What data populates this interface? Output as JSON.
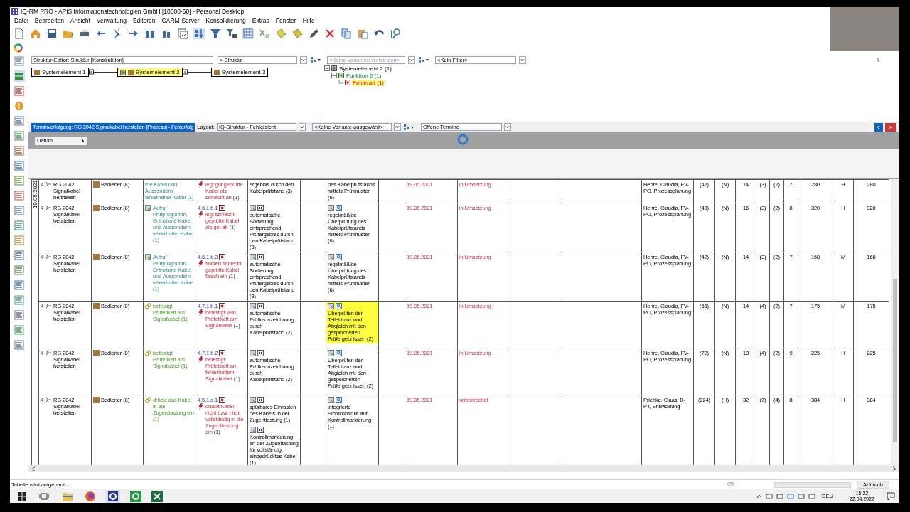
{
  "window": {
    "title": "IQ-RM PRO - APIS Informationstechnologien GmbH [10000-50] - Personal Desktop"
  },
  "menu": [
    "Datei",
    "Bearbeiten",
    "Ansicht",
    "Verwaltung",
    "Editoren",
    "CARM-Server",
    "Konsolidierung",
    "Extras",
    "Fenster",
    "Hilfe"
  ],
  "structure_editor": {
    "title": "Struktur-Editor: Struktur [Konstruktion]",
    "structure": "> Struktur",
    "variants": {
      "value": "<Keine Varianten vorhanden>",
      "disabled": true
    },
    "filter": "<Kein Filter>",
    "nodes": [
      {
        "label": "Systemelement 1",
        "selected": false
      },
      {
        "label": "Systemelement 2",
        "selected": true
      },
      {
        "label": "Systemelement 3",
        "selected": false
      }
    ],
    "tree": [
      {
        "kind": "system",
        "label": "Systemelement 2 (1)",
        "selected": false,
        "expanded": true,
        "children": [
          {
            "kind": "function",
            "label": "Funktion 2 (1)",
            "selected": false,
            "expanded": true,
            "children": [
              {
                "kind": "failure",
                "label": "Fehlerart (1)",
                "selected": true
              }
            ]
          }
        ]
      }
    ]
  },
  "schedule_bar": {
    "title": "Terminverfolgung: RG 2042 Signalkabel herstellen [Prozess] - Fehlerfolg",
    "layout_label": "Layout:",
    "layout": "IQ-Struktur - Fehlersicht",
    "variant": "<Keine Variante ausgewählt>",
    "filter": "Offene Termine"
  },
  "sort_header": {
    "label": "Datum",
    "sort": "▲"
  },
  "date_group": "19.05.2021",
  "rows": [
    {
      "number": "4",
      "process": "RG 2042 Signalkabel herstellen",
      "role": "Bediener (8)",
      "function": {
        "kind": "step",
        "text": "me Kabel und Aussondern fehlerhafter Kabel (1)",
        "icon": false
      },
      "failure": {
        "text": "legt gut geprüfte Kabel als schlecht ab",
        "count": "(1)"
      },
      "measures": [
        {
          "text": "ergebnis durch den Kabelprüfstand (3)",
          "icons": false
        }
      ],
      "planned": {
        "text": "des Kabelprüfstands mittels Prüfmuster (6)",
        "icons": false,
        "highlighted": false
      },
      "date": "19.05.2021",
      "status": "in Umsetzung",
      "responsible": "Hehre, Claudia, FV-PO, Prozessplanung",
      "values": [
        "(42)",
        "(N)",
        "14",
        "(3)",
        "(2)",
        "7",
        "280",
        "H",
        "280"
      ]
    },
    {
      "number": "4",
      "process": "RG 2042 Signalkabel herstellen",
      "role": "Bediener (8)",
      "function": {
        "kind": "step",
        "text": "Aufruf Prüfprogramm, Entnahme Kabel und Aussondern fehlerhafter Kabel (1)",
        "icon": true
      },
      "failure": {
        "code": "4.6.1.b.1",
        "text": "legt schlecht geprüfte Kabel als gut ab",
        "count": "(1)"
      },
      "measures": [
        {
          "text": "automatische Sortierung entsprechend Prüfergebnis durch den Kabelprüfstand (3)",
          "icons": true
        }
      ],
      "planned": {
        "text": "regelmäßige Überprüfung des Kabelprüfstands mittels Prüfmuster (6)",
        "icons": true,
        "highlighted": false
      },
      "date": "19.05.2021",
      "status": "in Umsetzung",
      "responsible": "Hehre, Claudia, FV-PO, Prozessplanung",
      "values": [
        "(48)",
        "(N)",
        "16",
        "(3)",
        "(2)",
        "8",
        "320",
        "H",
        "320"
      ]
    },
    {
      "number": "4",
      "process": "RG 2042 Signalkabel herstellen",
      "role": "Bediener (8)",
      "function": {
        "kind": "step",
        "text": "Aufruf Prüfprogramm, Entnahme Kabel und Aussondern fehlerhafter Kabel (1)",
        "icon": true
      },
      "failure": {
        "code": "4.6.1.b.3",
        "text": "sortiert schlecht geprüfte Kabel falsch ein",
        "count": "(1)"
      },
      "measures": [
        {
          "text": "automatische Sortierung entsprechend Prüfergebnis durch den Kabelprüfstand (3)",
          "icons": true
        }
      ],
      "planned": {
        "text": "regelmäßige Überprüfung des Kabelprüfstands mittels Prüfmuster (6)",
        "icons": true,
        "highlighted": false
      },
      "date": "19.05.2021",
      "status": "in Umsetzung",
      "responsible": "Hehre, Claudia, FV-PO, Prozessplanung",
      "values": [
        "(42)",
        "(N)",
        "14",
        "(3)",
        "(2)",
        "7",
        "168",
        "M",
        "168"
      ]
    },
    {
      "number": "4",
      "process": "RG 2042 Signalkabel herstellen",
      "role": "Bediener (8)",
      "function": {
        "kind": "function",
        "text": "befestigt Prüfetikett am Signalkabel (1)",
        "icon": true
      },
      "failure": {
        "code": "4.7.1.b.1",
        "text": "befestigt kein Prüfetikett am Signalkabel",
        "count": "(1)"
      },
      "measures": [
        {
          "text": "automatische Prüfkennzeichnung durch Kabelprüfstand (2)",
          "icons": true
        }
      ],
      "planned": {
        "text": "Überprüfen der Teilebilanz und Abgleich mit den gespeicherten Prüfergebnissen (2)",
        "icons": true,
        "highlighted": true
      },
      "date": "19.05.2021",
      "status": "in Umsetzung",
      "responsible": "Hehre, Claudia, FV-PO, Prozessplanung",
      "values": [
        "(56)",
        "(N)",
        "14",
        "(4)",
        "(2)",
        "7",
        "175",
        "M",
        "175"
      ]
    },
    {
      "number": "4",
      "process": "RG 2042 Signalkabel herstellen",
      "role": "Bediener (8)",
      "function": {
        "kind": "function",
        "text": "befestigt Prüfetikett am Signalkabel (1)",
        "icon": true
      },
      "failure": {
        "code": "4.7.1.b.2",
        "text": "befestigt Prüfetikett an fehlerhaftem Signalkabel",
        "count": "(1)"
      },
      "measures": [
        {
          "text": "automatische Prüfkennzeichnung durch Kabelprüfstand (2)",
          "icons": true
        }
      ],
      "planned": {
        "text": "Überprüfen der Teilebilanz und Abgleich mit den gespeicherten Prüfergebnissen (2)",
        "icons": true,
        "highlighted": false
      },
      "date": "19.05.2021",
      "status": "in Umsetzung",
      "responsible": "Hehre, Claudia, FV-PO, Prozessplanung",
      "values": [
        "(72)",
        "(N)",
        "18",
        "(4)",
        "(2)",
        "9",
        "225",
        "H",
        "225"
      ]
    },
    {
      "number": "4",
      "process": "RG 2042 Signalkabel herstellen",
      "role": "Bediener (8)",
      "function": {
        "kind": "function",
        "text": "drückt das Kabel in die Zugentlastung ein (1)",
        "icon": true
      },
      "failure": {
        "code": "4.5.1.a.1",
        "text": "drückt Kabel nicht bzw. nicht vollständig in die Zugentlastung ein",
        "count": "(1)"
      },
      "measures": [
        {
          "text": "spürbares Einrasten des Kabels in der Zugentlastung (1)",
          "icons": true
        },
        {
          "text": "Kontrollmarkierung an der Zugentlastung für vollständig eingedrücktes Kabel (1)",
          "icons": true
        }
      ],
      "planned": {
        "text": "integrierte Sichtkontrolle auf Kontrollmarkierung (1)",
        "icons": true,
        "highlighted": false
      },
      "date": "19.05.2021",
      "status": "unbearbeitet",
      "responsible": "Priebke, Claas, D-PT, Entwicklung",
      "values": [
        "(224)",
        "(H)",
        "32",
        "(7)",
        "(4)",
        "8",
        "384",
        "H",
        "384"
      ]
    }
  ],
  "status_bar": {
    "message": "Tabelle wird aufgebaut...",
    "percent": "0%",
    "progress": {
      "level": 0
    },
    "cancel": "Abbruch"
  },
  "taskbar": {
    "language": "DEU",
    "time": "15:22",
    "date": "22.04.2022"
  }
}
